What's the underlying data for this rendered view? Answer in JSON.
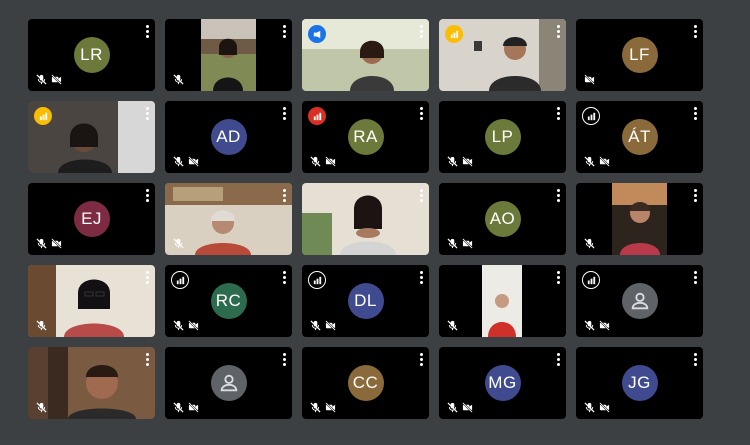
{
  "participants": [
    {
      "initials": "LR",
      "avatar_color": "#6b7a3a",
      "mic_off": true,
      "cam_off": true
    },
    {
      "initials": "",
      "video": true,
      "scene": "woman-outdoor",
      "mic_off": true,
      "cam_off": false
    },
    {
      "initials": "",
      "video": true,
      "scene": "woman-sun",
      "mic_off": false,
      "cam_off": false,
      "badge": "presenting",
      "badge_color": "#1a73e8",
      "active": true
    },
    {
      "initials": "",
      "video": true,
      "scene": "man-room",
      "mic_off": false,
      "cam_off": false,
      "badge": "speaking",
      "badge_color": "#fbbc04"
    },
    {
      "initials": "LF",
      "avatar_color": "#8a6a3a",
      "mic_off": false,
      "cam_off": true
    },
    {
      "initials": "",
      "video": true,
      "scene": "woman-dark",
      "mic_off": false,
      "cam_off": false,
      "badge": "speaking",
      "badge_color": "#fbbc04"
    },
    {
      "initials": "AD",
      "avatar_color": "#3f4b8e",
      "mic_off": true,
      "cam_off": true
    },
    {
      "initials": "RA",
      "avatar_color": "#6b7a3a",
      "mic_off": true,
      "cam_off": true,
      "badge": "speaking",
      "badge_color": "#d93025"
    },
    {
      "initials": "LP",
      "avatar_color": "#6b7a3a",
      "mic_off": true,
      "cam_off": true
    },
    {
      "initials": "ÁT",
      "avatar_color": "#8a6a3a",
      "mic_off": true,
      "cam_off": true,
      "badge": "speaking-muted",
      "badge_color": "#5f6368"
    },
    {
      "initials": "EJ",
      "avatar_color": "#7d2b43",
      "mic_off": true,
      "cam_off": true
    },
    {
      "initials": "",
      "video": true,
      "scene": "elder-woman",
      "mic_off": true,
      "cam_off": false
    },
    {
      "initials": "",
      "video": true,
      "scene": "woman-hands",
      "mic_off": false,
      "cam_off": false
    },
    {
      "initials": "AO",
      "avatar_color": "#6b7a3a",
      "mic_off": true,
      "cam_off": true
    },
    {
      "initials": "",
      "video": true,
      "scene": "woman-red",
      "mic_off": true,
      "cam_off": false
    },
    {
      "initials": "",
      "video": true,
      "scene": "woman-glasses",
      "mic_off": true,
      "cam_off": false
    },
    {
      "initials": "RC",
      "avatar_color": "#2d6b4e",
      "mic_off": true,
      "cam_off": true,
      "badge": "speaking-muted",
      "badge_color": "#5f6368"
    },
    {
      "initials": "DL",
      "avatar_color": "#3f4b8e",
      "mic_off": true,
      "cam_off": true,
      "badge": "speaking-muted",
      "badge_color": "#5f6368"
    },
    {
      "initials": "",
      "video": true,
      "scene": "man-red",
      "mic_off": true,
      "cam_off": false
    },
    {
      "initials": "",
      "avatar_icon": "person-icon",
      "avatar_color": "#5f6368",
      "mic_off": true,
      "cam_off": true,
      "badge": "speaking-muted",
      "badge_color": "#5f6368"
    },
    {
      "initials": "",
      "video": true,
      "scene": "woman-shelf",
      "mic_off": true,
      "cam_off": false
    },
    {
      "initials": "",
      "avatar_icon": "person-icon",
      "avatar_color": "#5f6368",
      "mic_off": true,
      "cam_off": true
    },
    {
      "initials": "CC",
      "avatar_color": "#8a6a3a",
      "mic_off": true,
      "cam_off": true
    },
    {
      "initials": "MG",
      "avatar_color": "#3f4b8e",
      "mic_off": true,
      "cam_off": true
    },
    {
      "initials": "JG",
      "avatar_color": "#3f4b8e",
      "mic_off": true,
      "cam_off": true
    }
  ],
  "colors": {
    "background": "#3c4043",
    "tile": "#000000",
    "active_border": "#4285f4"
  }
}
